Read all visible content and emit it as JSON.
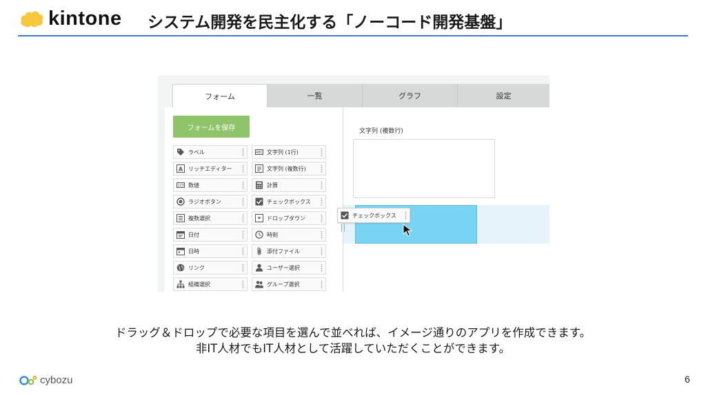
{
  "brand": {
    "name": "kintone",
    "cloud_color": "#f7c83e"
  },
  "slide": {
    "title": "システム開発を民主化する「ノーコード開発基盤」",
    "accent": "#3f7ac1",
    "page_number": "6"
  },
  "app": {
    "tabs": [
      {
        "label": "フォーム",
        "active": true
      },
      {
        "label": "一覧",
        "active": false
      },
      {
        "label": "グラフ",
        "active": false
      },
      {
        "label": "設定",
        "active": false
      }
    ],
    "save_button": "フォームを保存",
    "save_button_color": "#8fc46a",
    "palette": [
      {
        "label": "ラベル",
        "icon": "tag-icon"
      },
      {
        "label": "文字列 (1行)",
        "icon": "text-single-icon"
      },
      {
        "label": "リッチエディター",
        "icon": "rich-editor-icon"
      },
      {
        "label": "文字列 (複数行)",
        "icon": "text-multi-icon"
      },
      {
        "label": "数値",
        "icon": "number-icon"
      },
      {
        "label": "計算",
        "icon": "calculator-icon"
      },
      {
        "label": "ラジオボタン",
        "icon": "radio-icon"
      },
      {
        "label": "チェックボックス",
        "icon": "checkbox-icon"
      },
      {
        "label": "複数選択",
        "icon": "multi-select-icon"
      },
      {
        "label": "ドロップダウン",
        "icon": "dropdown-icon"
      },
      {
        "label": "日付",
        "icon": "calendar-icon"
      },
      {
        "label": "時刻",
        "icon": "clock-icon"
      },
      {
        "label": "日時",
        "icon": "datetime-icon"
      },
      {
        "label": "添付ファイル",
        "icon": "paperclip-icon"
      },
      {
        "label": "リンク",
        "icon": "globe-icon"
      },
      {
        "label": "ユーザー選択",
        "icon": "user-icon"
      },
      {
        "label": "組織選択",
        "icon": "org-icon"
      },
      {
        "label": "グループ選択",
        "icon": "group-icon"
      }
    ],
    "canvas_field_label": "文字列 (複数行)",
    "dragging_item": {
      "label": "チェックボックス",
      "icon": "checkbox-icon"
    },
    "drop_target_color": "#79d4f3"
  },
  "caption": {
    "line1": "ドラッグ＆ドロップで必要な項目を選んで並べれば、イメージ通りのアプリを作成できます。",
    "line2": "非IT人材でもIT人材として活躍していただくことができます。"
  },
  "footer": {
    "brand": "cybozu"
  }
}
